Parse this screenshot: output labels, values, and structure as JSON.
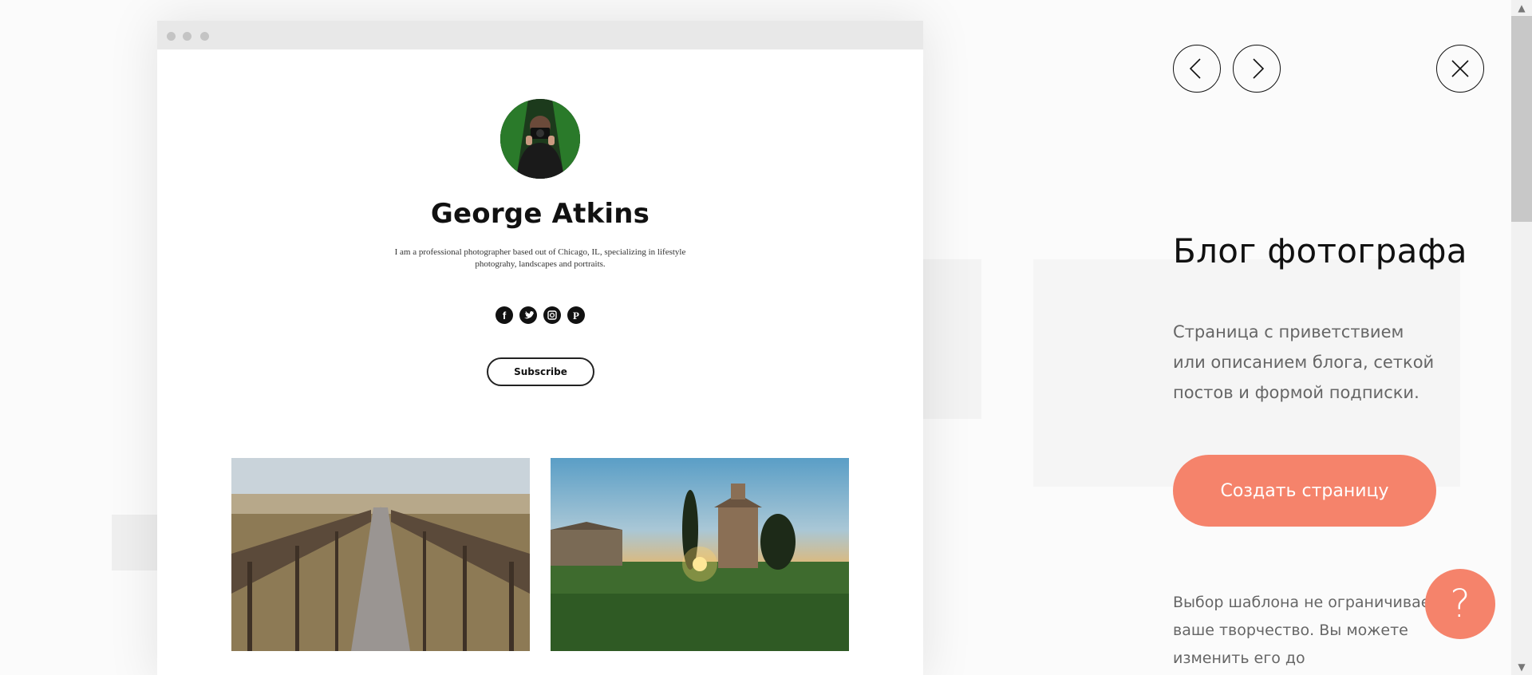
{
  "preview": {
    "author_name": "George Atkins",
    "author_bio": "I am a professional photographer based out of Chicago, IL, specializing in lifestyle photograhy, landscapes and portraits.",
    "subscribe_label": "Subscribe",
    "socials": [
      "facebook-icon",
      "twitter-icon",
      "instagram-icon",
      "pinterest-icon"
    ]
  },
  "panel": {
    "title": "Блог фотографа",
    "description": "Страница с приветствием или описанием блога, сеткой постов и формой подписки.",
    "create_label": "Создать страницу",
    "note": "Выбор шаблона не ограничивает ваше творчество. Вы можете изменить его до неузнаваемости"
  },
  "help": {
    "label": "?"
  },
  "colors": {
    "accent": "#f5836b"
  }
}
